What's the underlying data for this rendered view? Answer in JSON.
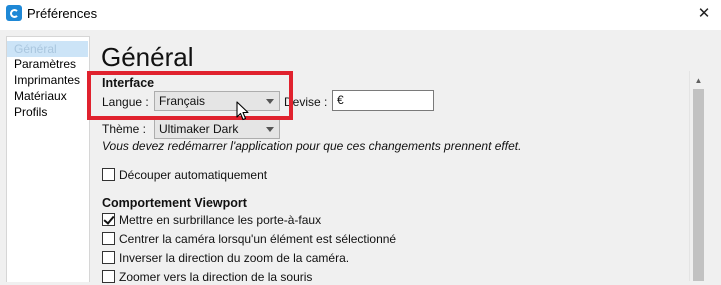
{
  "window": {
    "title": "Préférences",
    "close_glyph": "✕",
    "app_icon": "cura-app-icon"
  },
  "sidebar": {
    "items": [
      {
        "label": "Général",
        "selected": true
      },
      {
        "label": "Paramètres",
        "selected": false
      },
      {
        "label": "Imprimantes",
        "selected": false
      },
      {
        "label": "Matériaux",
        "selected": false
      },
      {
        "label": "Profils",
        "selected": false
      }
    ]
  },
  "page": {
    "title": "Général"
  },
  "interface": {
    "section_title": "Interface",
    "language_label": "Langue :",
    "language_value": "Français",
    "currency_label": "Devise :",
    "currency_value": "€",
    "theme_label": "Thème :",
    "theme_value": "Ultimaker Dark",
    "restart_note": "Vous devez redémarrer l'application pour que ces changements prennent effet.",
    "auto_slice_label": "Découper automatiquement",
    "auto_slice_checked": false
  },
  "viewport": {
    "section_title": "Comportement Viewport",
    "options": [
      {
        "label": "Mettre en surbrillance les porte-à-faux",
        "checked": true
      },
      {
        "label": "Centrer la caméra lorsqu'un élément est sélectionné",
        "checked": false
      },
      {
        "label": "Inverser la direction du zoom de la caméra.",
        "checked": false
      },
      {
        "label": "Zoomer vers la direction de la souris",
        "checked": false
      }
    ]
  },
  "colors": {
    "highlight": "#e0222e",
    "selection": "#cce4f7"
  }
}
